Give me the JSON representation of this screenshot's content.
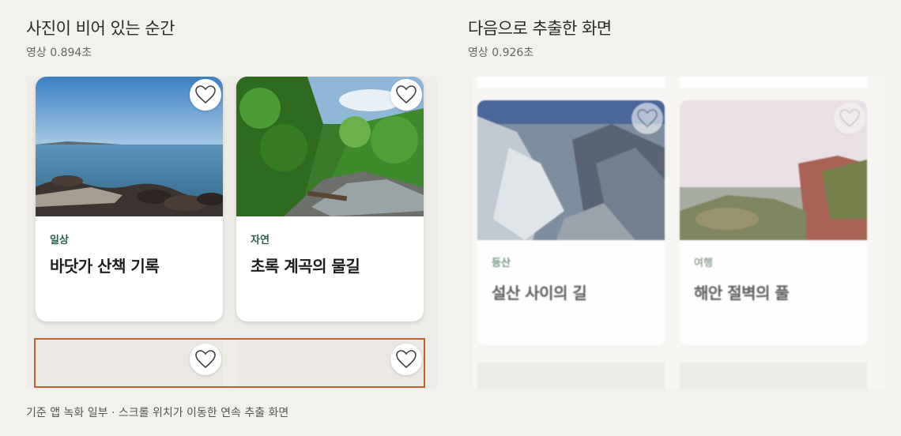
{
  "left": {
    "title": "사진이 비어 있는 순간",
    "subtitle": "영상 0.894초",
    "cards": [
      {
        "category": "일상",
        "title": "바닷가 산책 기록",
        "icon": "heart-outline-icon"
      },
      {
        "category": "자연",
        "title": "초록 계곡의 물길",
        "icon": "heart-outline-icon"
      }
    ]
  },
  "right": {
    "title": "다음으로 추출한 화면",
    "subtitle": "영상 0.926초",
    "cards": [
      {
        "category": "등산",
        "title": "설산 사이의 길",
        "icon": "heart-outline-icon"
      },
      {
        "category": "여행",
        "title": "해안 절벽의 풀",
        "icon": "heart-outline-icon"
      }
    ]
  },
  "caption": "기준 앱 녹화 일부 · 스크롤 위치가 이동한 연속 추출 화면",
  "colors": {
    "background": "#f3f1ec",
    "category_text": "#2e5e4e",
    "highlight_border": "#c2612e"
  }
}
